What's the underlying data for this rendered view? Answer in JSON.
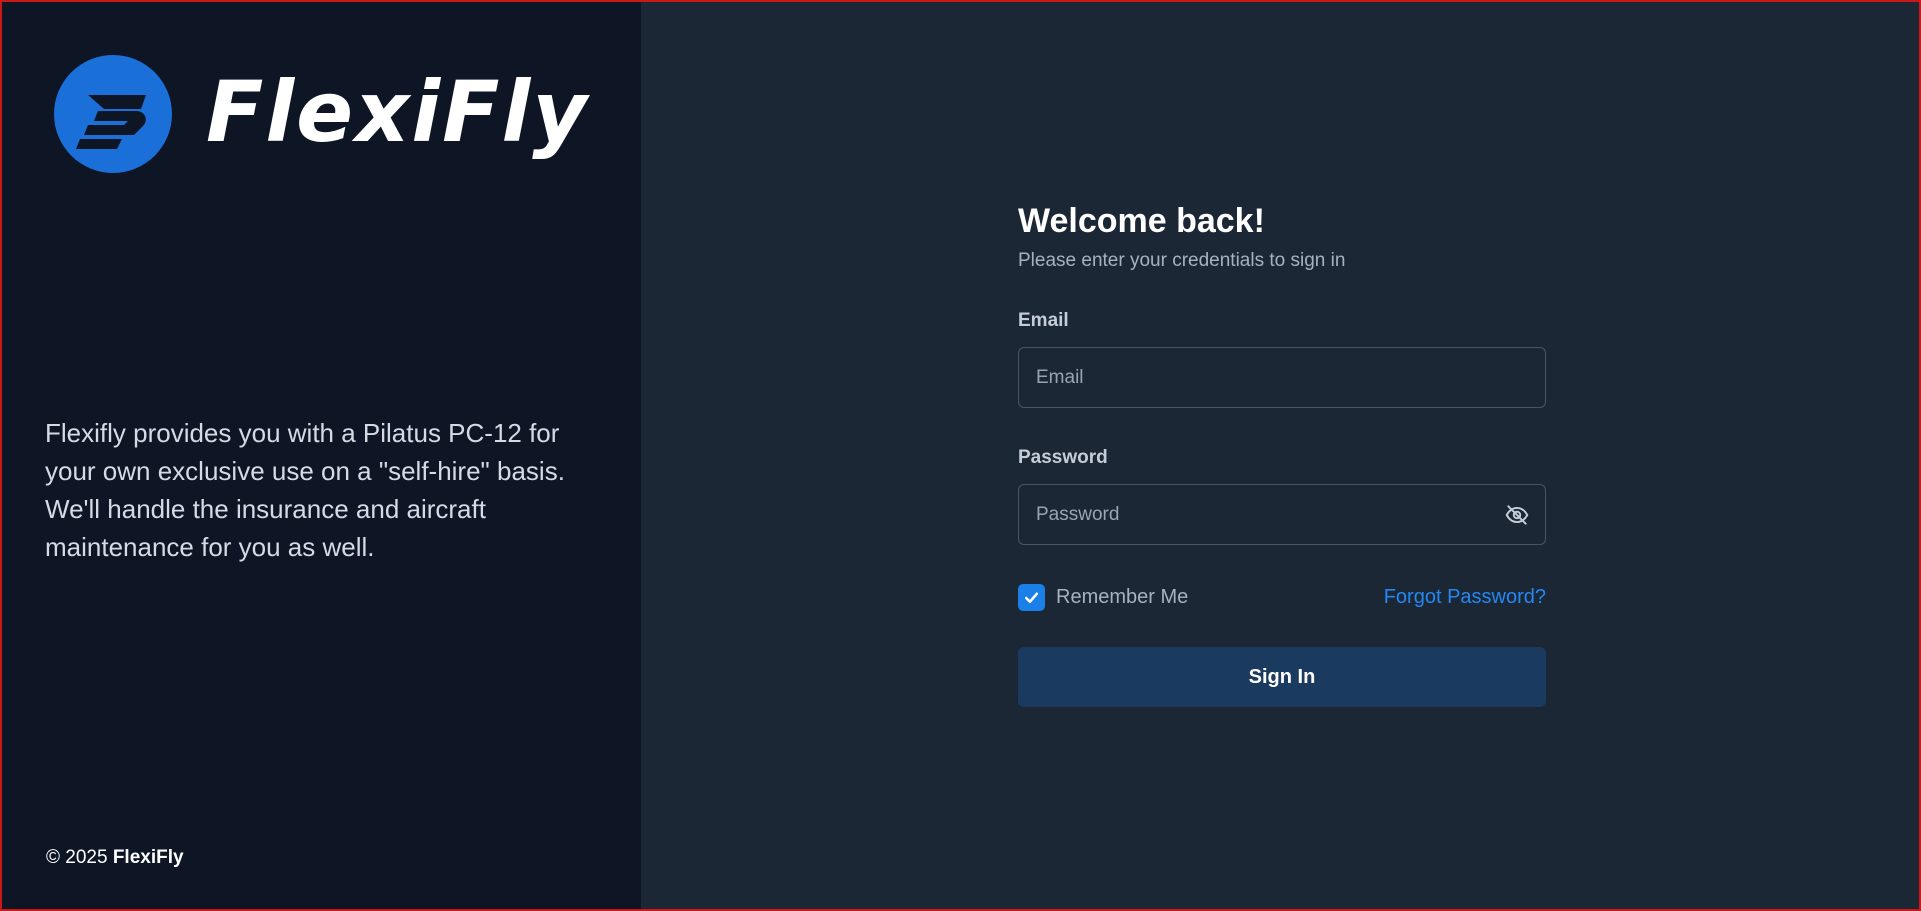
{
  "brand": {
    "name": "FlexiFly",
    "logo_icon": "flexifly-logo-icon",
    "accent_color": "#1a6fd8"
  },
  "left_panel": {
    "tagline": "Flexifly provides you with a Pilatus PC-12 for your own exclusive use on a \"self-hire\" basis. We'll handle the insurance and aircraft maintenance for you as well.",
    "copyright_prefix": "© 2025",
    "copyright_brand": "FlexiFly"
  },
  "login": {
    "heading": "Welcome back!",
    "subheading": "Please enter your credentials to sign in",
    "email": {
      "label": "Email",
      "placeholder": "Email",
      "value": ""
    },
    "password": {
      "label": "Password",
      "placeholder": "Password",
      "value": "",
      "toggle_icon": "eye-off-icon"
    },
    "remember_me": {
      "label": "Remember Me",
      "checked": true
    },
    "forgot_password_label": "Forgot Password?",
    "submit_label": "Sign In"
  },
  "colors": {
    "left_panel_bg": "#0e1626",
    "form_bg": "#1c2736",
    "link": "#2487f2",
    "checkbox": "#1a7fe6",
    "button_bg": "#1b3a5f"
  }
}
